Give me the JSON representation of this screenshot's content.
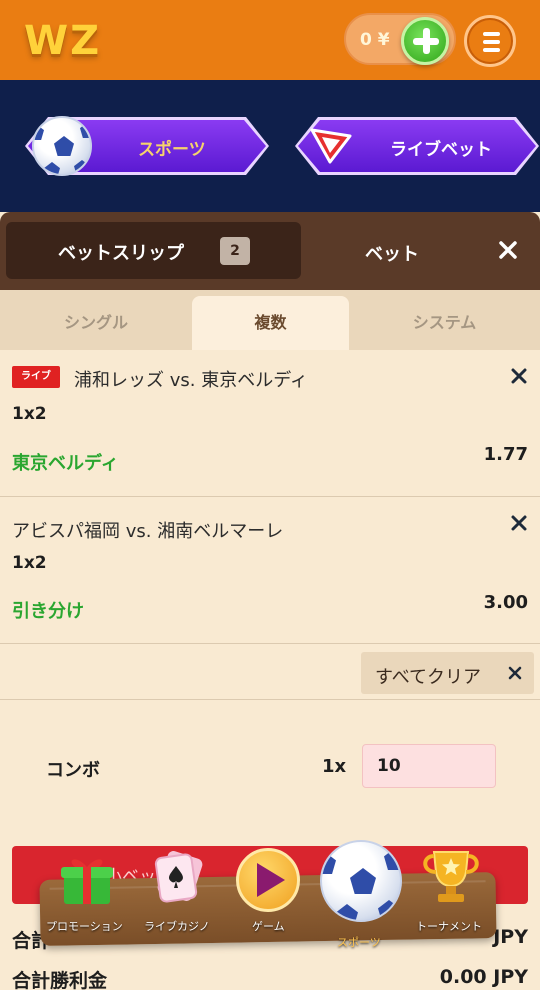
{
  "header": {
    "logo": "WZ",
    "balance": "0 ¥"
  },
  "hero": {
    "sports_label": "スポーツ",
    "live_label": "ライブベット"
  },
  "slip": {
    "tab_label": "ベットスリップ",
    "count": "2",
    "bet_tab_label": "ベット"
  },
  "bet_types": [
    "シングル",
    "複数",
    "システム"
  ],
  "active_bet_type": "複数",
  "bets": [
    {
      "live_badge": "ライブ",
      "match": "浦和レッズ vs. 東京ベルディ",
      "market": "1x2",
      "selection": "東京ベルディ",
      "odds": "1.77"
    },
    {
      "live_badge": "",
      "match": "アビスパ福岡 vs. 湘南ベルマーレ",
      "market": "1x2",
      "selection": "引き分け",
      "odds": "3.00"
    }
  ],
  "clear_all_label": "すべてクリア",
  "combo": {
    "label": "コンボ",
    "multiplier": "1x",
    "stake": "10"
  },
  "place_bet_label": "最小ベット",
  "totals": {
    "total_label": "合計",
    "total_value": "JPY",
    "winnings_label": "合計勝利金",
    "winnings_value": "0.00 JPY"
  },
  "dock": [
    {
      "label": "プロモーション",
      "icon": "gift-icon"
    },
    {
      "label": "ライブカジノ",
      "icon": "cards-icon"
    },
    {
      "label": "ゲーム",
      "icon": "game-icon"
    },
    {
      "label": "スポーツ",
      "icon": "soccer-ball-icon"
    },
    {
      "label": "トーナメント",
      "icon": "trophy-icon"
    }
  ],
  "colors": {
    "header": "#ea7d12",
    "hero_bg": "#0f1f4b",
    "slip_header": "#5a3a28",
    "selection_green": "#2aa630",
    "live_red": "#e02222",
    "place_bet_red": "#d9252e"
  }
}
